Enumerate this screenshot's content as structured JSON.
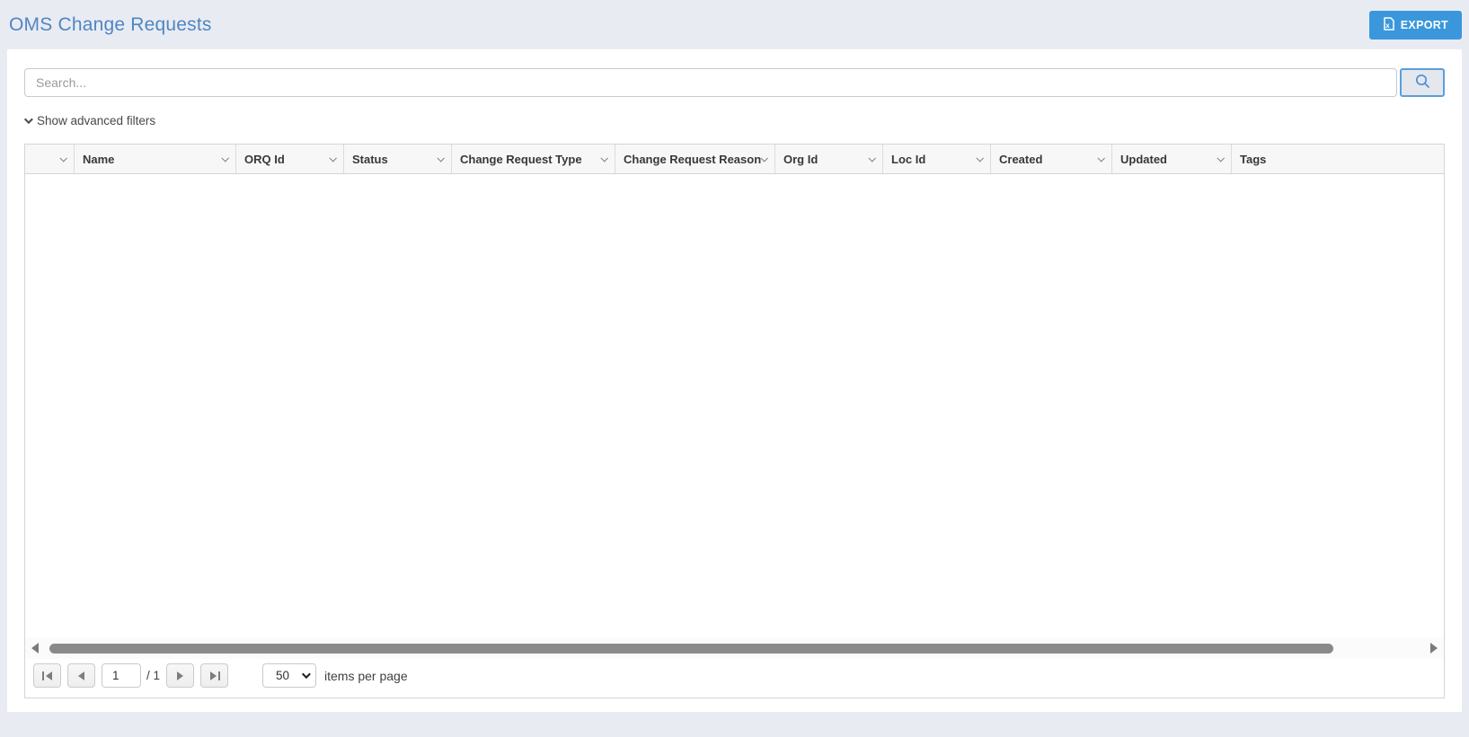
{
  "page": {
    "title": "OMS Change Requests",
    "background_color": "#e9ebf3",
    "title_color": "#4e86c2",
    "accent_blue": "#3a97dc"
  },
  "toolbar": {
    "export_label": "EXPORT",
    "export_icon": "excel-file-icon"
  },
  "search": {
    "placeholder": "Search...",
    "button_icon": "magnifier-icon"
  },
  "filters": {
    "toggle_label": "Show advanced filters",
    "toggle_icon": "chevron-down-icon"
  },
  "grid": {
    "columns": [
      {
        "label": "",
        "has_menu": true
      },
      {
        "label": "Name",
        "has_menu": true
      },
      {
        "label": "ORQ Id",
        "has_menu": true
      },
      {
        "label": "Status",
        "has_menu": true
      },
      {
        "label": "Change Request Type",
        "has_menu": true
      },
      {
        "label": "Change Request Reason",
        "has_menu": true
      },
      {
        "label": "Org Id",
        "has_menu": true
      },
      {
        "label": "Loc Id",
        "has_menu": true
      },
      {
        "label": "Created",
        "has_menu": true
      },
      {
        "label": "Updated",
        "has_menu": true
      },
      {
        "label": "Tags",
        "has_menu": false
      }
    ],
    "rows": []
  },
  "pager": {
    "page_value": "1",
    "page_total_label": "/ 1",
    "page_size_value": "50",
    "items_per_page_label": "items per page"
  }
}
